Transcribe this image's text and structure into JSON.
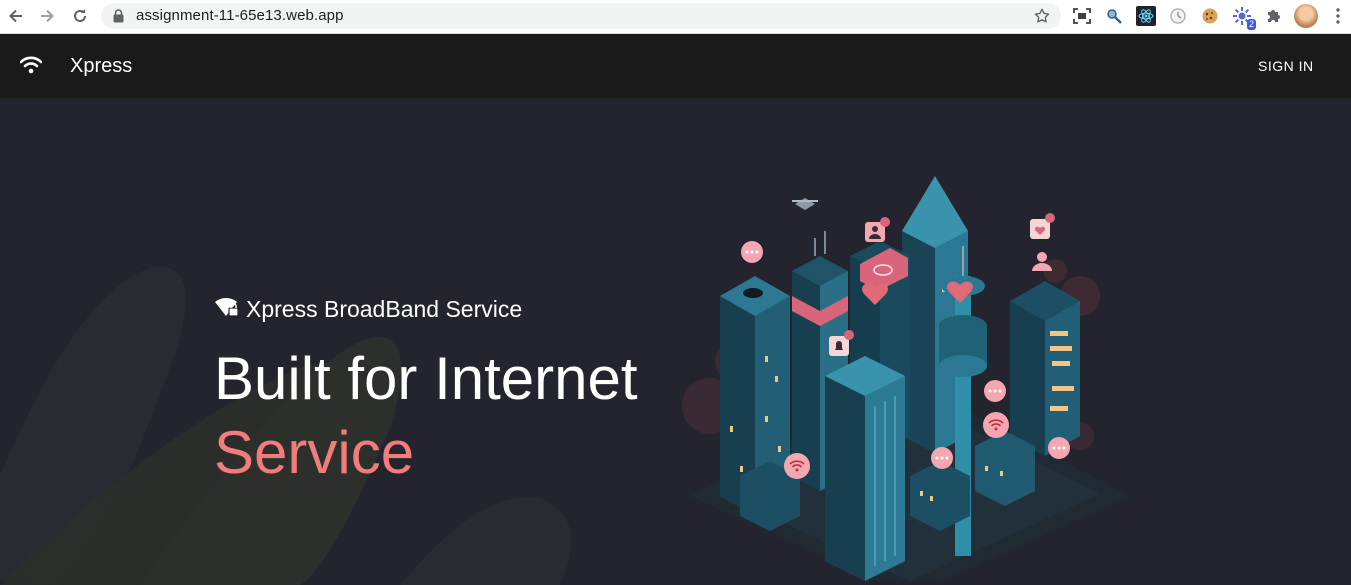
{
  "browser": {
    "url": "assignment-11-65e13.web.app",
    "extension_badge": "2",
    "icons": [
      "back-icon",
      "forward-icon",
      "reload-icon",
      "lock-icon",
      "star-icon",
      "screenshot-icon",
      "search-ext-icon",
      "react-icon",
      "timer-icon",
      "cookie-icon",
      "gear-ext-icon",
      "puzzle-icon",
      "avatar",
      "menu-icon"
    ]
  },
  "header": {
    "brand": "Xpress",
    "sign_in": "SIGN IN"
  },
  "hero": {
    "tagline": "Xpress BroadBand Service",
    "headline": "Built for Internet",
    "headline_accent": "Service",
    "accent_color": "#f07c7c"
  },
  "colors": {
    "appbar": "#1a1a1a",
    "hero_bg": "#24242e",
    "accent": "#f07c7c",
    "tower_teal": "#2a6f86"
  }
}
